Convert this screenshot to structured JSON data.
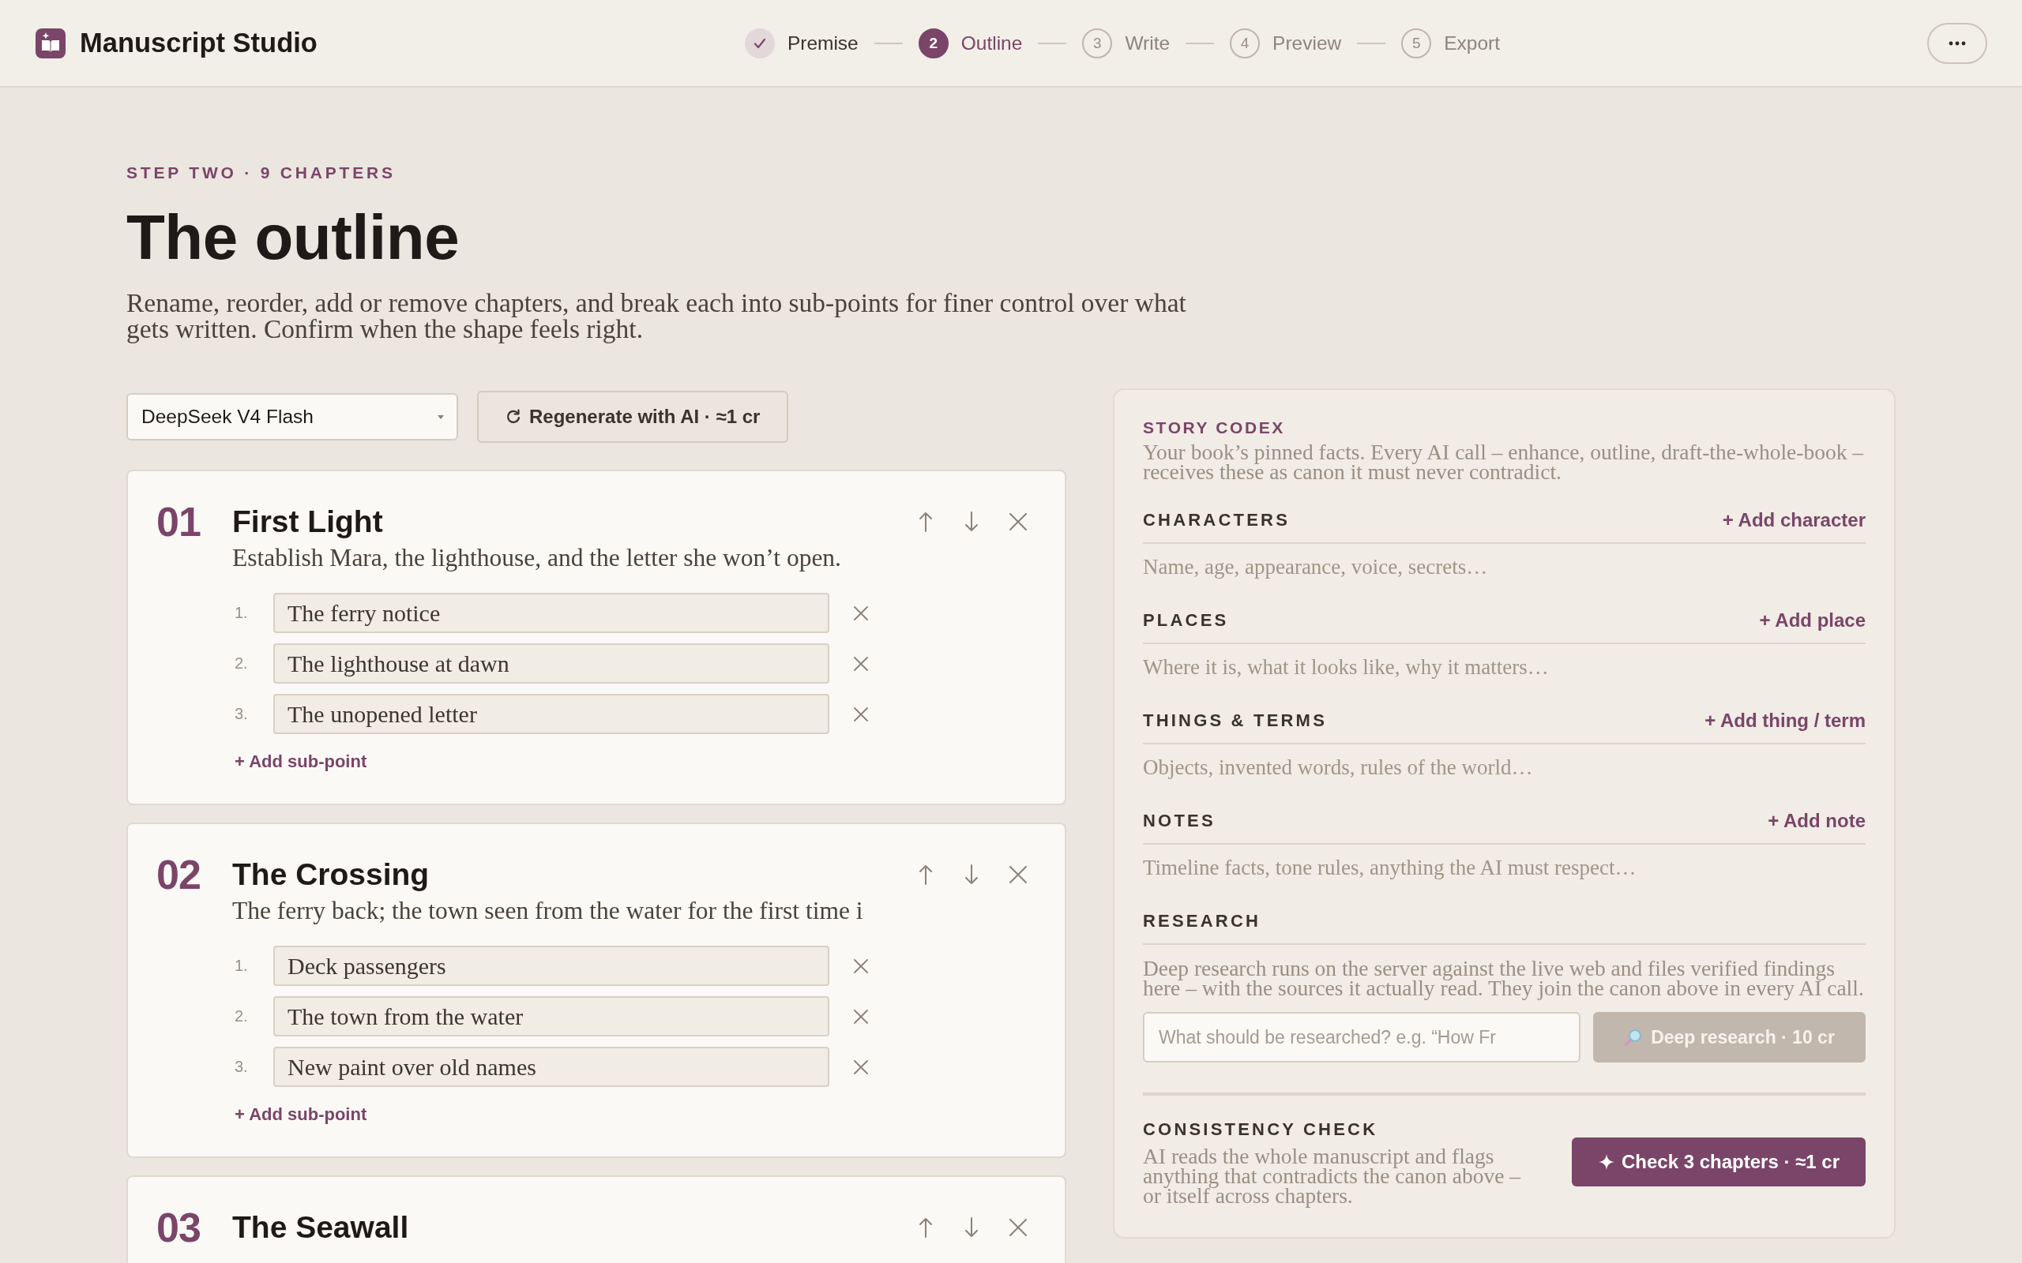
{
  "app": {
    "name": "Manuscript Studio"
  },
  "steps": [
    {
      "label": "Premise",
      "completed": true,
      "selected": false
    },
    {
      "number": "2",
      "label": "Outline",
      "completed": false,
      "selected": true
    },
    {
      "number": "3",
      "label": "Write",
      "completed": false,
      "selected": false
    },
    {
      "number": "4",
      "label": "Preview",
      "completed": false,
      "selected": false
    },
    {
      "number": "5",
      "label": "Export",
      "completed": false,
      "selected": false
    }
  ],
  "intro": {
    "eyebrow": "STEP TWO · 9 CHAPTERS",
    "title": "The outline",
    "description": "Rename, reorder, add or remove chapters, and break each into sub-points for finer control over what gets written. Confirm when the shape feels right."
  },
  "toolbar": {
    "model_select": {
      "value": "DeepSeek V4 Flash"
    },
    "regenerate_button": "Regenerate with AI · ≈1 cr"
  },
  "chapters": [
    {
      "number": "01",
      "title": "First Light",
      "summary": "Establish Mara, the lighthouse, and the letter she won’t open.",
      "sub_points": [
        {
          "number": "1.",
          "value": "The ferry notice"
        },
        {
          "number": "2.",
          "value": "The lighthouse at dawn"
        },
        {
          "number": "3.",
          "value": "The unopened letter"
        }
      ],
      "add_sub_point": "+ Add sub-point"
    },
    {
      "number": "02",
      "title": "The Crossing",
      "summary": "The ferry back; the town seen from the water for the first time i",
      "sub_points": [
        {
          "number": "1.",
          "value": "Deck passengers"
        },
        {
          "number": "2.",
          "value": "The town from the water"
        },
        {
          "number": "3.",
          "value": "New paint over old names"
        }
      ],
      "add_sub_point": "+ Add sub-point"
    },
    {
      "number": "03",
      "title": "The Seawall"
    }
  ],
  "codex": {
    "title": "STORY CODEX",
    "description": "Your book’s pinned facts. Every AI call – enhance, outline, draft-the-whole-book – receives these as canon it must never contradict.",
    "sections": [
      {
        "heading": "CHARACTERS",
        "add_link": "+ Add character",
        "empty_hint": "Name, age, appearance, voice, secrets…"
      },
      {
        "heading": "PLACES",
        "add_link": "+ Add place",
        "empty_hint": "Where it is, what it looks like, why it matters…"
      },
      {
        "heading": "THINGS & TERMS",
        "add_link": "+ Add thing / term",
        "empty_hint": "Objects, invented words, rules of the world…"
      },
      {
        "heading": "NOTES",
        "add_link": "+ Add note",
        "empty_hint": "Timeline facts, tone rules, anything the AI must respect…"
      }
    ],
    "research": {
      "heading": "RESEARCH",
      "description": "Deep research runs on the server against the live web and files verified findings here – with the sources it actually read. They join the canon above in every AI call.",
      "query_field": {
        "placeholder": "What should be researched? e.g. “How Fr"
      },
      "button": {
        "label": "Deep research · 10 cr",
        "disabled": true
      }
    },
    "consistency_check": {
      "heading": "CONSISTENCY CHECK",
      "description": "AI reads the whole manuscript and flags anything that contradicts the canon above – or itself across chapters.",
      "button": "Check 3 chapters · ≈1 cr"
    }
  }
}
